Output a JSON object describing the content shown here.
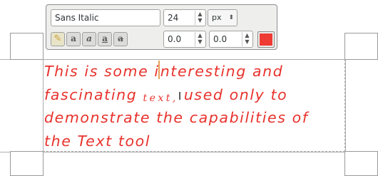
{
  "toolbar": {
    "font_name": "Sans Italic",
    "font_size": "24",
    "unit": "px",
    "baseline_offset": "0.0",
    "kerning": "0.0",
    "text_color": "#ee3b34"
  },
  "text_layer": {
    "lines": {
      "l1_a": "This is some i",
      "l1_b": "nteresting and",
      "l2_a": "fascinating ",
      "l2_small": "text,",
      "l2_b": "used only to",
      "l3": "demonstrate the capabilities of",
      "l4": "the Text tool"
    },
    "color": "#e8322c"
  },
  "icons": {
    "clear": "brush-clear-icon",
    "antialias": "antialias-icon",
    "italic": "italic-style-icon",
    "underline": "underline-icon",
    "strikethrough": "strikethrough-icon",
    "cursor": "ibeam-cursor-icon"
  }
}
